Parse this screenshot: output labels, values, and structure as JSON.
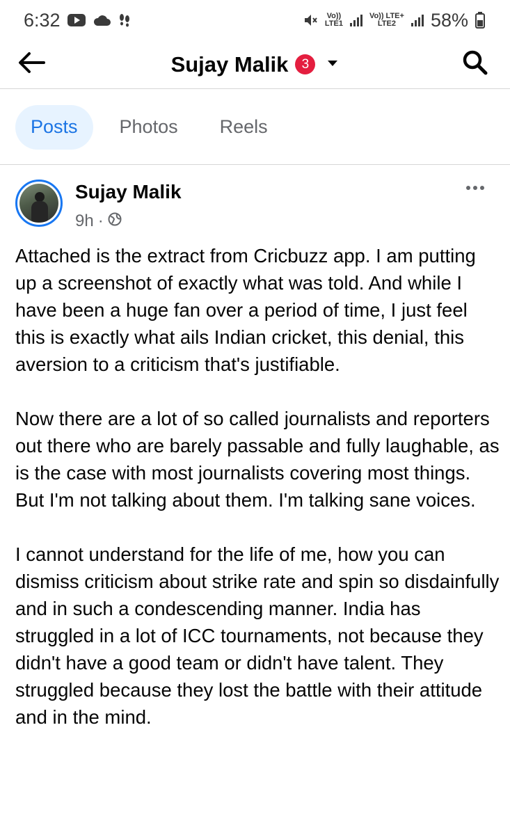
{
  "status_bar": {
    "time": "6:32",
    "net1_top": "Vo))",
    "net1_bottom": "LTE1",
    "net2_top": "Vo)) LTE+",
    "net2_bottom": "LTE2",
    "battery": "58%"
  },
  "header": {
    "title": "Sujay Malik",
    "badge": "3"
  },
  "tabs": [
    {
      "label": "Posts",
      "active": true
    },
    {
      "label": "Photos",
      "active": false
    },
    {
      "label": "Reels",
      "active": false
    }
  ],
  "post": {
    "author": "Sujay Malik",
    "time": "9h",
    "separator": "·",
    "paragraphs": [
      "Attached is the extract from Cricbuzz app. I am putting up a screenshot of exactly what was told. And while I have been a huge fan over a period of time, I just feel this is exactly what ails Indian cricket, this denial, this aversion to a criticism that's justifiable.",
      "Now there are a lot of so called journalists and reporters out there who are barely passable and fully laughable, as is the case with most journalists covering most things. But I'm not talking about them. I'm talking sane voices.",
      "I cannot understand for the life of me, how you can dismiss criticism about strike rate and spin so disdainfully and in such a condescending manner. India has struggled in a lot of ICC tournaments, not because they didn't have a good team or didn't have talent. They struggled because they lost the battle with their attitude and in the mind."
    ]
  },
  "colors": {
    "accent": "#1b74e4",
    "tab_active_bg": "#e7f3ff",
    "badge": "#e41e3f",
    "secondary_text": "#65676b"
  },
  "icons": {
    "back": "arrow-left-icon",
    "search": "search-icon",
    "caret": "chevron-down-icon",
    "more": "more-horizontal-icon",
    "privacy": "globe-icon"
  }
}
